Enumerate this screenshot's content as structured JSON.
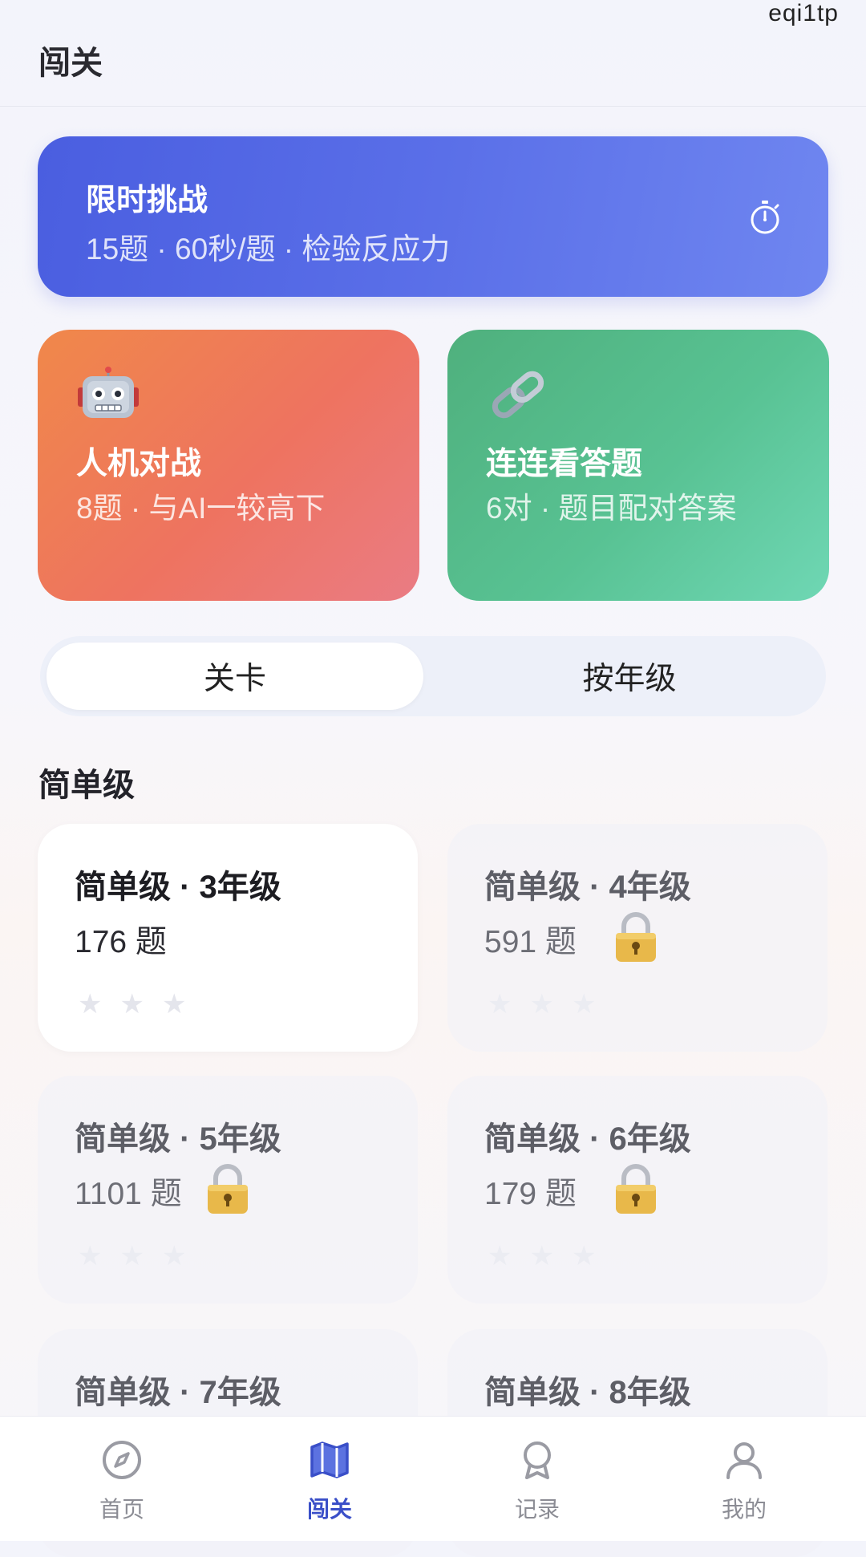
{
  "watermark": "eqi1tp",
  "header": {
    "title": "闯关"
  },
  "challenge": {
    "title": "限时挑战",
    "subtitle": "15题 · 60秒/题 · 检验反应力",
    "icon": "stopwatch-icon"
  },
  "modes": [
    {
      "title": "人机对战",
      "desc": "8题 · 与AI一较高下",
      "icon": "robot-icon"
    },
    {
      "title": "连连看答题",
      "desc": "6对 · 题目配对答案",
      "icon": "link-icon"
    }
  ],
  "tabs": [
    {
      "label": "关卡",
      "active": true
    },
    {
      "label": "按年级",
      "active": false
    }
  ],
  "section": {
    "title": "简单级"
  },
  "levels": [
    {
      "title": "简单级 · 3年级",
      "count": "176 题",
      "locked": false,
      "stars": 0
    },
    {
      "title": "简单级 · 4年级",
      "count": "591 题",
      "locked": true,
      "stars": 0
    },
    {
      "title": "简单级 · 5年级",
      "count": "1101 题",
      "locked": true,
      "stars": 0
    },
    {
      "title": "简单级 · 6年级",
      "count": "179 题",
      "locked": true,
      "stars": 0
    },
    {
      "title": "简单级 · 7年级",
      "count": "",
      "locked": true,
      "stars": 0
    },
    {
      "title": "简单级 · 8年级",
      "count": "",
      "locked": true,
      "stars": 0
    }
  ],
  "nav": [
    {
      "label": "首页",
      "icon": "compass-icon",
      "active": false
    },
    {
      "label": "闯关",
      "icon": "map-icon",
      "active": true
    },
    {
      "label": "记录",
      "icon": "badge-icon",
      "active": false
    },
    {
      "label": "我的",
      "icon": "user-icon",
      "active": false
    }
  ],
  "colors": {
    "accent": "#3a4fc8",
    "challenge_start": "#4a5ee0",
    "challenge_end": "#6f86f0",
    "ai_card": "#ee7360",
    "link_card": "#58c293",
    "lock_gold": "#e8b84a"
  }
}
